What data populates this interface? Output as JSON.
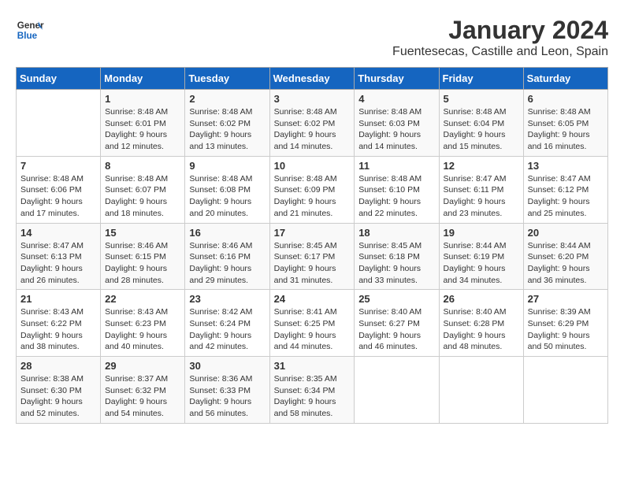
{
  "header": {
    "logo_general": "General",
    "logo_blue": "Blue",
    "month": "January 2024",
    "location": "Fuentesecas, Castille and Leon, Spain"
  },
  "columns": [
    "Sunday",
    "Monday",
    "Tuesday",
    "Wednesday",
    "Thursday",
    "Friday",
    "Saturday"
  ],
  "weeks": [
    [
      {
        "day": null
      },
      {
        "day": 1,
        "sunrise": "8:48 AM",
        "sunset": "6:01 PM",
        "daylight": "9 hours and 12 minutes."
      },
      {
        "day": 2,
        "sunrise": "8:48 AM",
        "sunset": "6:02 PM",
        "daylight": "9 hours and 13 minutes."
      },
      {
        "day": 3,
        "sunrise": "8:48 AM",
        "sunset": "6:02 PM",
        "daylight": "9 hours and 14 minutes."
      },
      {
        "day": 4,
        "sunrise": "8:48 AM",
        "sunset": "6:03 PM",
        "daylight": "9 hours and 14 minutes."
      },
      {
        "day": 5,
        "sunrise": "8:48 AM",
        "sunset": "6:04 PM",
        "daylight": "9 hours and 15 minutes."
      },
      {
        "day": 6,
        "sunrise": "8:48 AM",
        "sunset": "6:05 PM",
        "daylight": "9 hours and 16 minutes."
      }
    ],
    [
      {
        "day": 7,
        "sunrise": "8:48 AM",
        "sunset": "6:06 PM",
        "daylight": "9 hours and 17 minutes."
      },
      {
        "day": 8,
        "sunrise": "8:48 AM",
        "sunset": "6:07 PM",
        "daylight": "9 hours and 18 minutes."
      },
      {
        "day": 9,
        "sunrise": "8:48 AM",
        "sunset": "6:08 PM",
        "daylight": "9 hours and 20 minutes."
      },
      {
        "day": 10,
        "sunrise": "8:48 AM",
        "sunset": "6:09 PM",
        "daylight": "9 hours and 21 minutes."
      },
      {
        "day": 11,
        "sunrise": "8:48 AM",
        "sunset": "6:10 PM",
        "daylight": "9 hours and 22 minutes."
      },
      {
        "day": 12,
        "sunrise": "8:47 AM",
        "sunset": "6:11 PM",
        "daylight": "9 hours and 23 minutes."
      },
      {
        "day": 13,
        "sunrise": "8:47 AM",
        "sunset": "6:12 PM",
        "daylight": "9 hours and 25 minutes."
      }
    ],
    [
      {
        "day": 14,
        "sunrise": "8:47 AM",
        "sunset": "6:13 PM",
        "daylight": "9 hours and 26 minutes."
      },
      {
        "day": 15,
        "sunrise": "8:46 AM",
        "sunset": "6:15 PM",
        "daylight": "9 hours and 28 minutes."
      },
      {
        "day": 16,
        "sunrise": "8:46 AM",
        "sunset": "6:16 PM",
        "daylight": "9 hours and 29 minutes."
      },
      {
        "day": 17,
        "sunrise": "8:45 AM",
        "sunset": "6:17 PM",
        "daylight": "9 hours and 31 minutes."
      },
      {
        "day": 18,
        "sunrise": "8:45 AM",
        "sunset": "6:18 PM",
        "daylight": "9 hours and 33 minutes."
      },
      {
        "day": 19,
        "sunrise": "8:44 AM",
        "sunset": "6:19 PM",
        "daylight": "9 hours and 34 minutes."
      },
      {
        "day": 20,
        "sunrise": "8:44 AM",
        "sunset": "6:20 PM",
        "daylight": "9 hours and 36 minutes."
      }
    ],
    [
      {
        "day": 21,
        "sunrise": "8:43 AM",
        "sunset": "6:22 PM",
        "daylight": "9 hours and 38 minutes."
      },
      {
        "day": 22,
        "sunrise": "8:43 AM",
        "sunset": "6:23 PM",
        "daylight": "9 hours and 40 minutes."
      },
      {
        "day": 23,
        "sunrise": "8:42 AM",
        "sunset": "6:24 PM",
        "daylight": "9 hours and 42 minutes."
      },
      {
        "day": 24,
        "sunrise": "8:41 AM",
        "sunset": "6:25 PM",
        "daylight": "9 hours and 44 minutes."
      },
      {
        "day": 25,
        "sunrise": "8:40 AM",
        "sunset": "6:27 PM",
        "daylight": "9 hours and 46 minutes."
      },
      {
        "day": 26,
        "sunrise": "8:40 AM",
        "sunset": "6:28 PM",
        "daylight": "9 hours and 48 minutes."
      },
      {
        "day": 27,
        "sunrise": "8:39 AM",
        "sunset": "6:29 PM",
        "daylight": "9 hours and 50 minutes."
      }
    ],
    [
      {
        "day": 28,
        "sunrise": "8:38 AM",
        "sunset": "6:30 PM",
        "daylight": "9 hours and 52 minutes."
      },
      {
        "day": 29,
        "sunrise": "8:37 AM",
        "sunset": "6:32 PM",
        "daylight": "9 hours and 54 minutes."
      },
      {
        "day": 30,
        "sunrise": "8:36 AM",
        "sunset": "6:33 PM",
        "daylight": "9 hours and 56 minutes."
      },
      {
        "day": 31,
        "sunrise": "8:35 AM",
        "sunset": "6:34 PM",
        "daylight": "9 hours and 58 minutes."
      },
      {
        "day": null
      },
      {
        "day": null
      },
      {
        "day": null
      }
    ]
  ]
}
